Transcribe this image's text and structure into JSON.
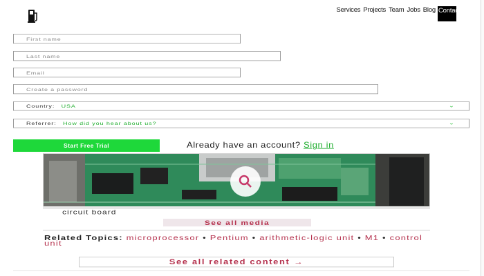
{
  "nav": {
    "items": [
      "Services",
      "Projects",
      "Team",
      "Jobs",
      "Blog"
    ],
    "active": "Contact"
  },
  "form": {
    "first_name_placeholder": "First name",
    "last_name_placeholder": "Last name",
    "email_placeholder": "Email",
    "password_placeholder": "Create a password",
    "country_label": "Country:",
    "country_value": "USA",
    "referrer_label": "Referrer:",
    "referrer_value": "How did you hear about us?",
    "cta_label": "Start Free Trial",
    "already_text": "Already have an account?",
    "sign_in_label": "Sign in"
  },
  "media": {
    "caption": "circuit board",
    "see_all_label": "See all media"
  },
  "related": {
    "label": "Related Topics:",
    "topics": [
      "microprocessor",
      "Pentium",
      "arithmetic-logic unit",
      "M1",
      "control unit"
    ],
    "separator": "•",
    "see_all_label": "See all related content →"
  },
  "colors": {
    "accent_green": "#1ed83a",
    "link_green": "#1fae2e",
    "topic_red": "#b5324e"
  },
  "icons": {
    "logo": "fuel-pump-icon",
    "chevron": "chevron-down-icon",
    "zoom": "magnifier-icon"
  }
}
